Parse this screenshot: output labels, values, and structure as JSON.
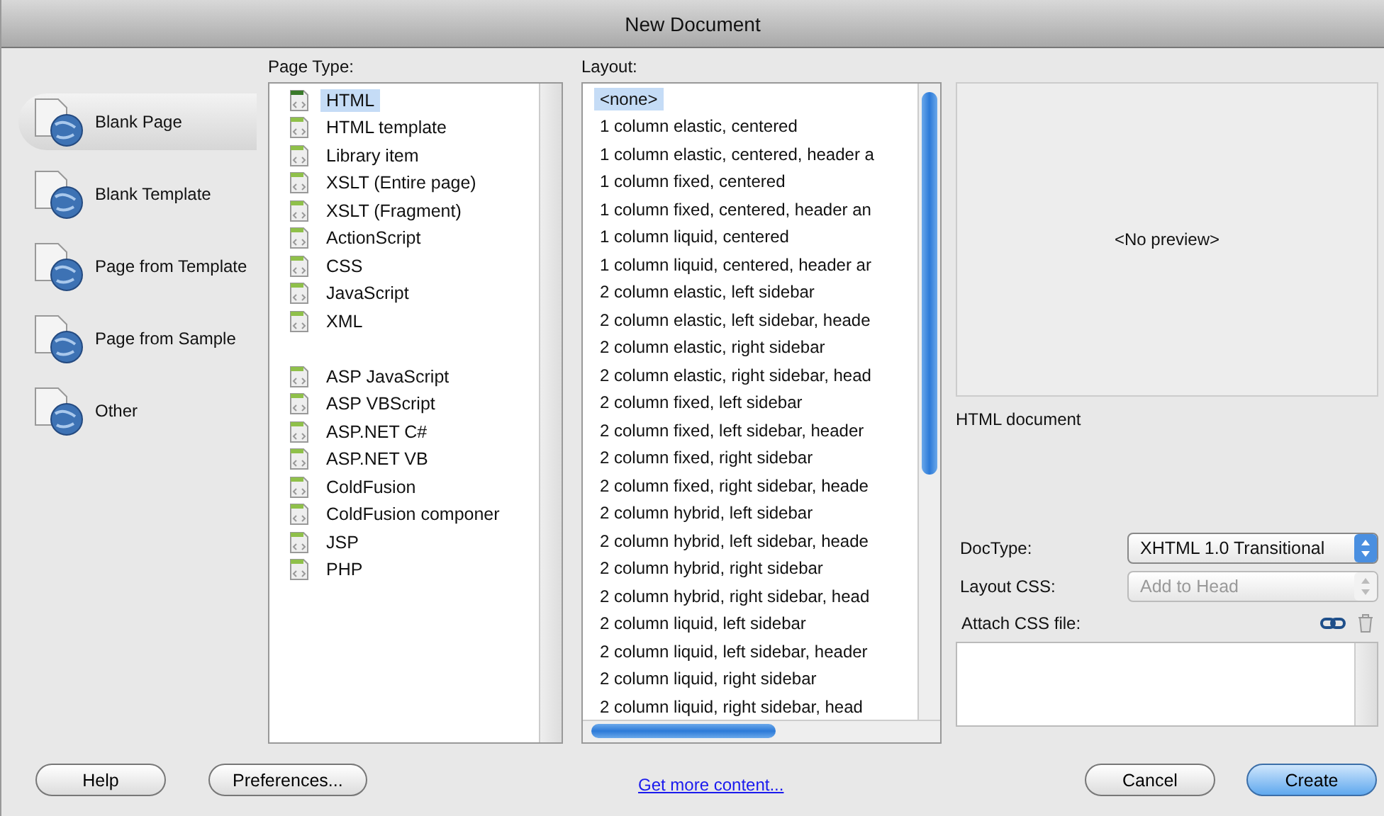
{
  "window": {
    "title": "New Document"
  },
  "categories": [
    {
      "label": "Blank Page",
      "selected": true
    },
    {
      "label": "Blank Template",
      "selected": false
    },
    {
      "label": "Page from Template",
      "selected": false
    },
    {
      "label": "Page from Sample",
      "selected": false
    },
    {
      "label": "Other",
      "selected": false
    }
  ],
  "page_type": {
    "heading": "Page Type:",
    "groups": [
      {
        "items": [
          {
            "label": "HTML",
            "selected": true
          },
          {
            "label": "HTML template",
            "selected": false
          },
          {
            "label": "Library item",
            "selected": false
          },
          {
            "label": "XSLT (Entire page)",
            "selected": false
          },
          {
            "label": "XSLT (Fragment)",
            "selected": false
          },
          {
            "label": "ActionScript",
            "selected": false
          },
          {
            "label": "CSS",
            "selected": false
          },
          {
            "label": "JavaScript",
            "selected": false
          },
          {
            "label": "XML",
            "selected": false
          }
        ]
      },
      {
        "items": [
          {
            "label": "ASP JavaScript",
            "selected": false
          },
          {
            "label": "ASP VBScript",
            "selected": false
          },
          {
            "label": "ASP.NET C#",
            "selected": false
          },
          {
            "label": "ASP.NET VB",
            "selected": false
          },
          {
            "label": "ColdFusion",
            "selected": false
          },
          {
            "label": "ColdFusion componer",
            "selected": false
          },
          {
            "label": "JSP",
            "selected": false
          },
          {
            "label": "PHP",
            "selected": false
          }
        ]
      }
    ]
  },
  "layout": {
    "heading": "Layout:",
    "items": [
      {
        "label": "<none>",
        "selected": true
      },
      {
        "label": "1 column elastic, centered",
        "selected": false
      },
      {
        "label": "1 column elastic, centered, header a",
        "selected": false
      },
      {
        "label": "1 column fixed, centered",
        "selected": false
      },
      {
        "label": "1 column fixed, centered, header an",
        "selected": false
      },
      {
        "label": "1 column liquid, centered",
        "selected": false
      },
      {
        "label": "1 column liquid, centered, header ar",
        "selected": false
      },
      {
        "label": "2 column elastic, left sidebar",
        "selected": false
      },
      {
        "label": "2 column elastic, left sidebar, heade",
        "selected": false
      },
      {
        "label": "2 column elastic, right sidebar",
        "selected": false
      },
      {
        "label": "2 column elastic, right sidebar, head",
        "selected": false
      },
      {
        "label": "2 column fixed, left sidebar",
        "selected": false
      },
      {
        "label": "2 column fixed, left sidebar, header",
        "selected": false
      },
      {
        "label": "2 column fixed, right sidebar",
        "selected": false
      },
      {
        "label": "2 column fixed, right sidebar, heade",
        "selected": false
      },
      {
        "label": "2 column hybrid, left sidebar",
        "selected": false
      },
      {
        "label": "2 column hybrid, left sidebar, heade",
        "selected": false
      },
      {
        "label": "2 column hybrid, right sidebar",
        "selected": false
      },
      {
        "label": "2 column hybrid, right sidebar, head",
        "selected": false
      },
      {
        "label": "2 column liquid, left sidebar",
        "selected": false
      },
      {
        "label": "2 column liquid, left sidebar, header",
        "selected": false
      },
      {
        "label": "2 column liquid, right sidebar",
        "selected": false
      },
      {
        "label": "2 column liquid, right sidebar, head",
        "selected": false
      }
    ]
  },
  "preview": {
    "text": "<No preview>",
    "description": "HTML document"
  },
  "doctype": {
    "label": "DocType:",
    "value": "XHTML 1.0 Transitional",
    "disabled": false
  },
  "layout_css": {
    "label": "Layout CSS:",
    "value": "Add to Head",
    "disabled": true
  },
  "attach_css": {
    "label": "Attach CSS file:"
  },
  "footer": {
    "buttons_left": [
      {
        "label": "Help",
        "default": false
      },
      {
        "label": "Preferences...",
        "default": false
      }
    ],
    "link": "Get more content...",
    "buttons_right": [
      {
        "label": "Cancel",
        "default": false
      },
      {
        "label": "Create",
        "default": true
      }
    ]
  }
}
